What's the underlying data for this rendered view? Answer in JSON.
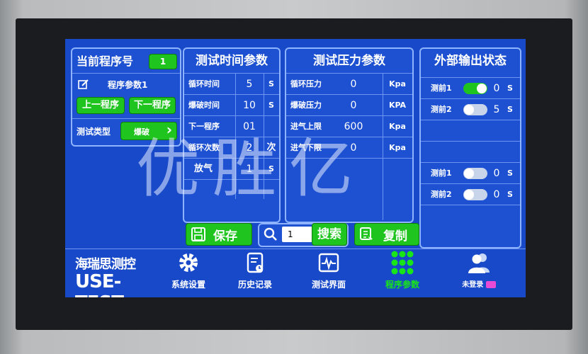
{
  "program_panel": {
    "title": "当前程序号",
    "program_no": "1",
    "program_name": "程序参数1",
    "prev_label": "上一程序",
    "next_label": "下一程序",
    "type_label": "测试类型",
    "type_value": "爆破",
    "type_arrow": "›"
  },
  "time_panel": {
    "title": "测试时间参数",
    "rows": [
      {
        "label": "循环时间",
        "value": "5",
        "unit": "S"
      },
      {
        "label": "爆破时间",
        "value": "10",
        "unit": "S"
      },
      {
        "label": "下一程序",
        "value": "01",
        "unit": ""
      },
      {
        "label": "循环次数",
        "value": "2",
        "unit": "次"
      },
      {
        "label": "放气",
        "value": "1",
        "unit": "S"
      }
    ]
  },
  "pressure_panel": {
    "title": "测试压力参数",
    "rows": [
      {
        "label": "循环压力",
        "value": "0",
        "unit": "Kpa"
      },
      {
        "label": "爆破压力",
        "value": "0",
        "unit": "KPA"
      },
      {
        "label": "进气上限",
        "value": "600",
        "unit": "Kpa"
      },
      {
        "label": "进气下限",
        "value": "0",
        "unit": "Kpa"
      }
    ]
  },
  "output_panel": {
    "title": "外部输出状态",
    "rows": [
      {
        "label": "测前1",
        "value": "0",
        "unit": "S",
        "on": true
      },
      {
        "label": "测前2",
        "value": "5",
        "unit": "S",
        "on": false
      },
      {
        "label": "测前1",
        "value": "0",
        "unit": "S",
        "on": false
      },
      {
        "label": "测前2",
        "value": "0",
        "unit": "S",
        "on": false
      }
    ]
  },
  "actions": {
    "save_label": "保存",
    "search_value": "1",
    "search_label": "搜索",
    "copy_label": "复制"
  },
  "brand": {
    "cn": "海瑞思测控",
    "en": "USE-TEST"
  },
  "nav": {
    "system": "系统设置",
    "history": "历史记录",
    "test": "测试界面",
    "program": "程序参数",
    "login": "未登录"
  },
  "watermark": "优胜亿",
  "colors": {
    "screen": "#1749c9",
    "accent_green": "#1fc41f",
    "active_nav": "#19e619"
  }
}
